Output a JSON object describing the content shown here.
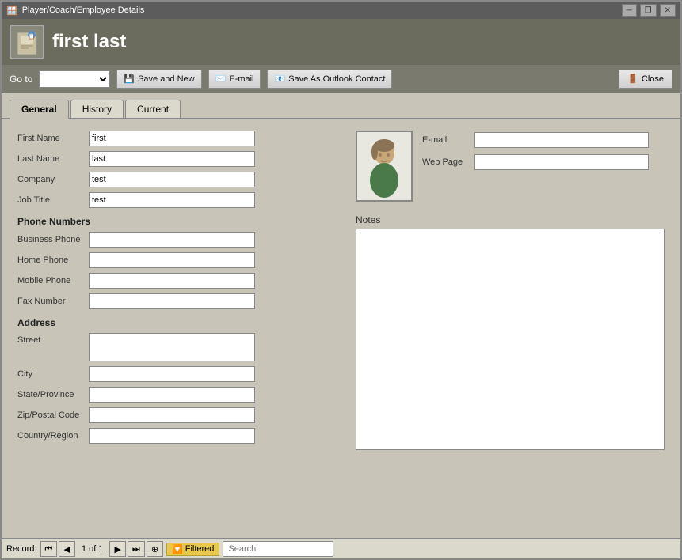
{
  "window": {
    "title": "Player/Coach/Employee Details",
    "controls": [
      "minimize",
      "restore",
      "close"
    ]
  },
  "header": {
    "title": "first last",
    "icon": "person-icon"
  },
  "toolbar": {
    "goto_label": "Go to",
    "goto_options": [
      ""
    ],
    "save_new_label": "Save and New",
    "email_label": "E-mail",
    "save_outlook_label": "Save As Outlook Contact",
    "close_label": "Close"
  },
  "tabs": [
    {
      "label": "General",
      "active": true
    },
    {
      "label": "History",
      "active": false
    },
    {
      "label": "Current",
      "active": false
    }
  ],
  "form": {
    "first_name_label": "First Name",
    "first_name_value": "first",
    "last_name_label": "Last Name",
    "last_name_value": "last",
    "company_label": "Company",
    "company_value": "test",
    "job_title_label": "Job Title",
    "job_title_value": "test",
    "phone_section_title": "Phone Numbers",
    "business_phone_label": "Business Phone",
    "business_phone_value": "",
    "home_phone_label": "Home Phone",
    "home_phone_value": "",
    "mobile_phone_label": "Mobile Phone",
    "mobile_phone_value": "",
    "fax_number_label": "Fax Number",
    "fax_number_value": "",
    "address_section_title": "Address",
    "street_label": "Street",
    "street_value": "",
    "city_label": "City",
    "city_value": "",
    "state_label": "State/Province",
    "state_value": "",
    "zip_label": "Zip/Postal Code",
    "zip_value": "",
    "country_label": "Country/Region",
    "country_value": "",
    "email_label": "E-mail",
    "email_value": "",
    "web_page_label": "Web Page",
    "web_page_value": "",
    "notes_label": "Notes",
    "notes_value": ""
  },
  "statusbar": {
    "record_label": "Record:",
    "first_btn": "⏮",
    "prev_btn": "◀",
    "record_of": "1 of 1",
    "next_btn": "▶",
    "last_btn": "⏭",
    "new_btn": "⊕",
    "filtered_icon": "🔽",
    "filtered_label": "Filtered",
    "search_placeholder": "Search"
  }
}
